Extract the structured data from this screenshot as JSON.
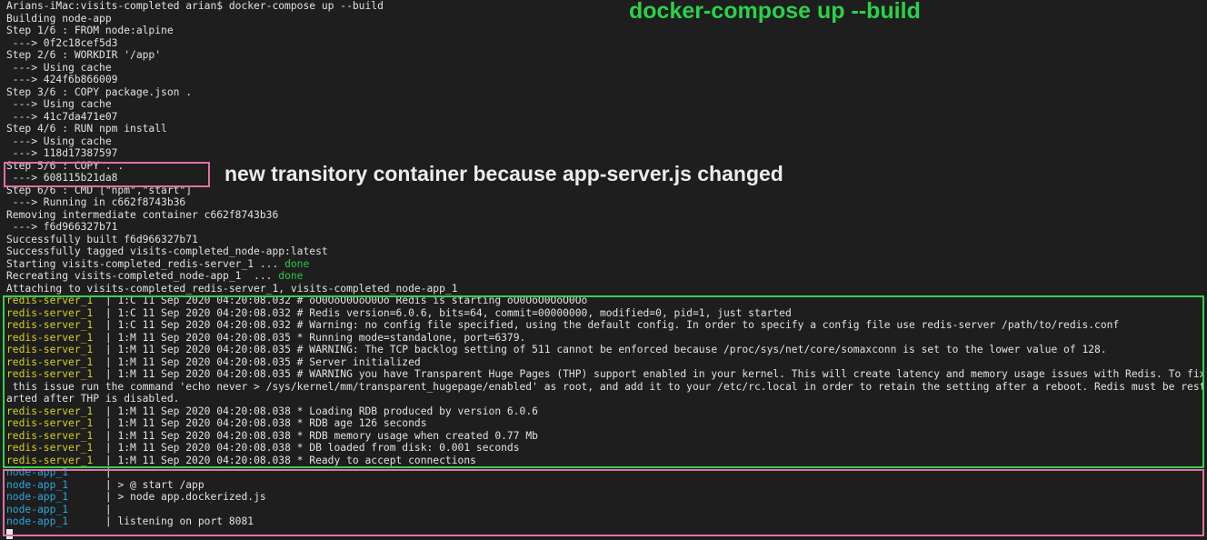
{
  "annotations": {
    "title": "docker-compose up --build",
    "copy_note": "new transitory container because app-server.js changed"
  },
  "colors": {
    "background": "#1e1e1e",
    "text": "#e2e2e2",
    "redis_prefix": "#d6d01c",
    "node_prefix": "#2aa7d8",
    "done": "#28c840",
    "highlight_pink": "#e070a5",
    "highlight_green": "#33d34a"
  },
  "build_lines": [
    "Arians-iMac:visits-completed arian$ docker-compose up --build",
    "Building node-app",
    "Step 1/6 : FROM node:alpine",
    " ---> 0f2c18cef5d3",
    "Step 2/6 : WORKDIR '/app'",
    " ---> Using cache",
    " ---> 424f6b866009",
    "Step 3/6 : COPY package.json .",
    " ---> Using cache",
    " ---> 41c7da471e07",
    "Step 4/6 : RUN npm install",
    " ---> Using cache",
    " ---> 118d17387597",
    "Step 5/6 : COPY . .",
    " ---> 608115b21da8",
    "Step 6/6 : CMD [\"npm\",\"start\"]",
    " ---> Running in c662f8743b36",
    "Removing intermediate container c662f8743b36",
    " ---> f6d966327b71",
    "Successfully built f6d966327b71",
    "Successfully tagged visits-completed_node-app:latest"
  ],
  "start_lines": [
    {
      "text": "Starting visits-completed_redis-server_1 ... ",
      "status": "done"
    },
    {
      "text": "Recreating visits-completed_node-app_1  ... ",
      "status": "done"
    }
  ],
  "attach_line": "Attaching to visits-completed_redis-server_1, visits-completed_node-app_1",
  "redis_prefix": "redis-server_1  ",
  "redis_logs": [
    {
      "prefix": "redis-server_1  ",
      "msg": " 1:C 11 Sep 2020 04:20:08.032 # oO0OoO0OoO0Oo Redis is starting oO0OoO0OoO0Oo"
    },
    {
      "prefix": "redis-server_1  ",
      "msg": " 1:C 11 Sep 2020 04:20:08.032 # Redis version=6.0.6, bits=64, commit=00000000, modified=0, pid=1, just started"
    },
    {
      "prefix": "redis-server_1  ",
      "msg": " 1:C 11 Sep 2020 04:20:08.032 # Warning: no config file specified, using the default config. In order to specify a config file use redis-server /path/to/redis.conf"
    },
    {
      "prefix": "redis-server_1  ",
      "msg": " 1:M 11 Sep 2020 04:20:08.035 * Running mode=standalone, port=6379."
    },
    {
      "prefix": "redis-server_1  ",
      "msg": " 1:M 11 Sep 2020 04:20:08.035 # WARNING: The TCP backlog setting of 511 cannot be enforced because /proc/sys/net/core/somaxconn is set to the lower value of 128."
    },
    {
      "prefix": "redis-server_1  ",
      "msg": " 1:M 11 Sep 2020 04:20:08.035 # Server initialized"
    },
    {
      "prefix": "redis-server_1  ",
      "msg": " 1:M 11 Sep 2020 04:20:08.035 # WARNING you have Transparent Huge Pages (THP) support enabled in your kernel. This will create latency and memory usage issues with Redis. To fix"
    },
    {
      "prefix": "",
      "msg": " this issue run the command 'echo never > /sys/kernel/mm/transparent_hugepage/enabled' as root, and add it to your /etc/rc.local in order to retain the setting after a reboot. Redis must be rest"
    },
    {
      "prefix": "",
      "msg": "arted after THP is disabled."
    },
    {
      "prefix": "redis-server_1  ",
      "msg": " 1:M 11 Sep 2020 04:20:08.038 * Loading RDB produced by version 6.0.6"
    },
    {
      "prefix": "redis-server_1  ",
      "msg": " 1:M 11 Sep 2020 04:20:08.038 * RDB age 126 seconds"
    },
    {
      "prefix": "redis-server_1  ",
      "msg": " 1:M 11 Sep 2020 04:20:08.038 * RDB memory usage when created 0.77 Mb"
    },
    {
      "prefix": "redis-server_1  ",
      "msg": " 1:M 11 Sep 2020 04:20:08.038 * DB loaded from disk: 0.001 seconds"
    },
    {
      "prefix": "redis-server_1  ",
      "msg": " 1:M 11 Sep 2020 04:20:08.038 * Ready to accept connections"
    }
  ],
  "node_logs": [
    {
      "prefix": "node-app_1      ",
      "msg": " "
    },
    {
      "prefix": "node-app_1      ",
      "msg": " > @ start /app"
    },
    {
      "prefix": "node-app_1      ",
      "msg": " > node app.dockerized.js"
    },
    {
      "prefix": "node-app_1      ",
      "msg": " "
    },
    {
      "prefix": "node-app_1      ",
      "msg": " listening on port 8081"
    }
  ]
}
